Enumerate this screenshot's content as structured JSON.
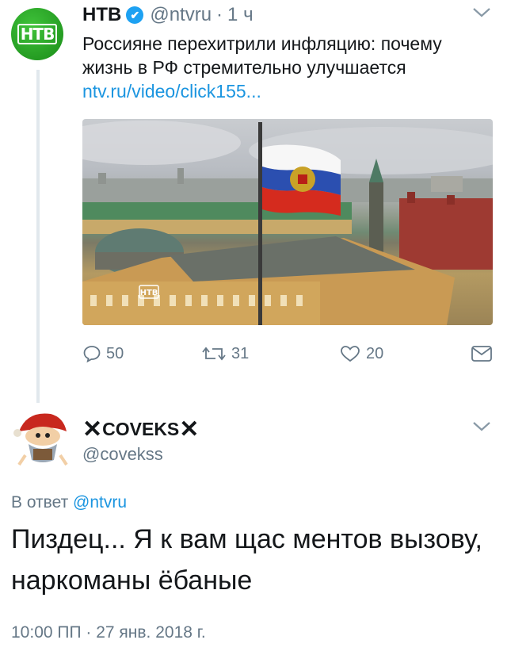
{
  "tweet": {
    "author_name": "НТВ",
    "verified_glyph": "✔",
    "handle": "@ntvru",
    "separator": "·",
    "time": "1 ч",
    "text": "Россияне перехитрили инфляцию: почему жизнь в РФ стремительно улучшается",
    "link": "ntv.ru/video/click155...",
    "avatar_logo": "НТВ",
    "media_watermark": "НТВ",
    "actions": {
      "replies": "50",
      "retweets": "31",
      "likes": "20"
    }
  },
  "reply": {
    "name_prefix": "✕",
    "name": "COVEKS",
    "name_suffix": "✕",
    "handle": "@covekss",
    "reply_to_label": "В ответ",
    "reply_to_mention": "@ntvru",
    "text": "Пиздец... Я к вам щас ментов вызову, наркоманы ёбаные",
    "timestamp": "10:00 ПП · 27 янв. 2018 г."
  },
  "colors": {
    "link": "#1b95e0",
    "muted": "#657786",
    "verified": "#1da1f2",
    "ntv_green": "#1a8c18"
  },
  "icons": [
    "verified-badge-icon",
    "chevron-down-icon",
    "reply-icon",
    "retweet-icon",
    "like-icon",
    "direct-message-icon"
  ]
}
